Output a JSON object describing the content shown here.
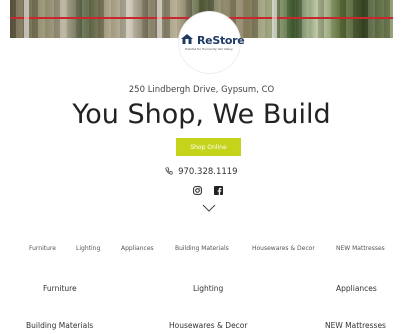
{
  "logo": {
    "name": "ReStore",
    "tagline": "Habitat for Humanity Vail Valley"
  },
  "hero": {
    "address": "250 Lindbergh Drive, Gypsum, CO",
    "headline": "You Shop, We Build",
    "cta_label": "Shop Online",
    "phone": "970.328.1119",
    "accent_color": "#c6d31b"
  },
  "social": {
    "icons": [
      "instagram-icon",
      "facebook-icon"
    ]
  },
  "nav": {
    "items": [
      "Furniture",
      "Lighting",
      "Appliances",
      "Building Materials",
      "Housewares & Decor",
      "NEW Mattresses"
    ]
  },
  "categories": {
    "row1": [
      "Furniture",
      "Lighting",
      "Appliances"
    ],
    "row2": [
      "Building Materials",
      "Housewares & Decor",
      "NEW Mattresses"
    ]
  }
}
